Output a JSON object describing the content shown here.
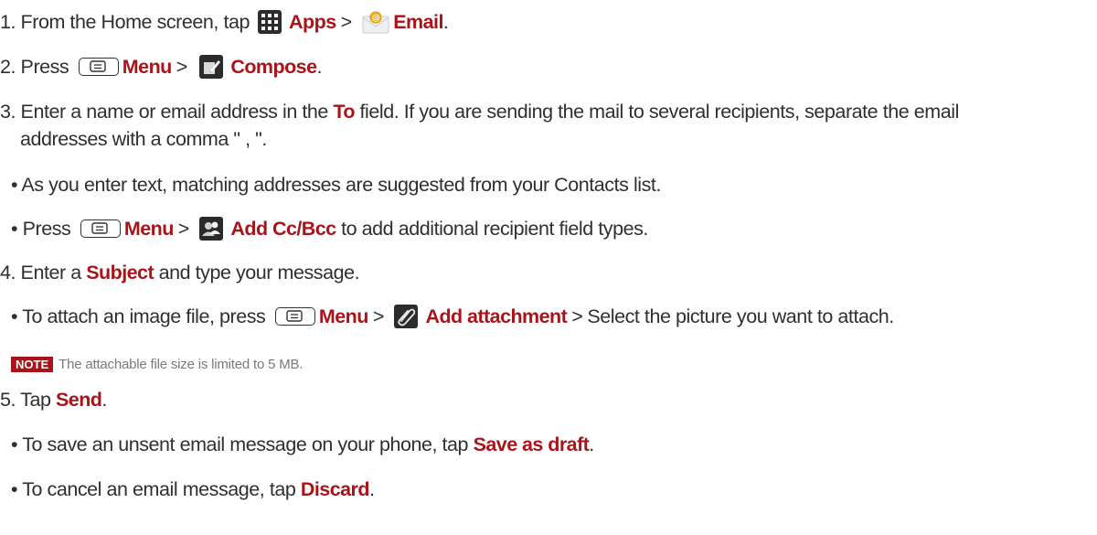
{
  "step1": {
    "prefix": "1. From the Home screen, tap ",
    "apps": "Apps",
    "gt": ">",
    "email": "Email",
    "end": "."
  },
  "step2": {
    "prefix": "2. Press ",
    "menu": "Menu",
    "gt": ">",
    "compose": "Compose",
    "end": "."
  },
  "step3": {
    "prefix": "3. Enter a name or email address in the ",
    "to": "To",
    "rest": " field. If you are sending the mail to several recipients, separate the email",
    "line2": "addresses with a comma \" , \"."
  },
  "bullet1": "• As you enter text, matching addresses are suggested from your Contacts list.",
  "bullet2": {
    "prefix": "• Press ",
    "menu": "Menu",
    "gt": ">",
    "add_cc": "Add Cc/Bcc",
    "rest": " to add additional recipient field types."
  },
  "step4": {
    "prefix": "4. Enter a ",
    "subject": "Subject",
    "rest": " and type your message."
  },
  "bullet3": {
    "prefix": "• To attach an image file, press ",
    "menu": "Menu",
    "gt": ">",
    "add_attachment": "Add attachment",
    "gt2": ">",
    "rest": "Select the picture you want to attach."
  },
  "note": {
    "badge": "NOTE",
    "text": "The attachable file size is limited to 5 MB."
  },
  "step5": {
    "prefix": "5. Tap ",
    "send": "Send",
    "end": "."
  },
  "bullet4": {
    "prefix": "• To save an unsent email message on your phone, tap ",
    "save": "Save as draft",
    "end": "."
  },
  "bullet5": {
    "prefix": "• To cancel an email message, tap ",
    "discard": "Discard",
    "end": "."
  },
  "colors": {
    "accent": "#a8141a",
    "text": "#2f2f2f",
    "note_text": "#7a7a7a"
  }
}
